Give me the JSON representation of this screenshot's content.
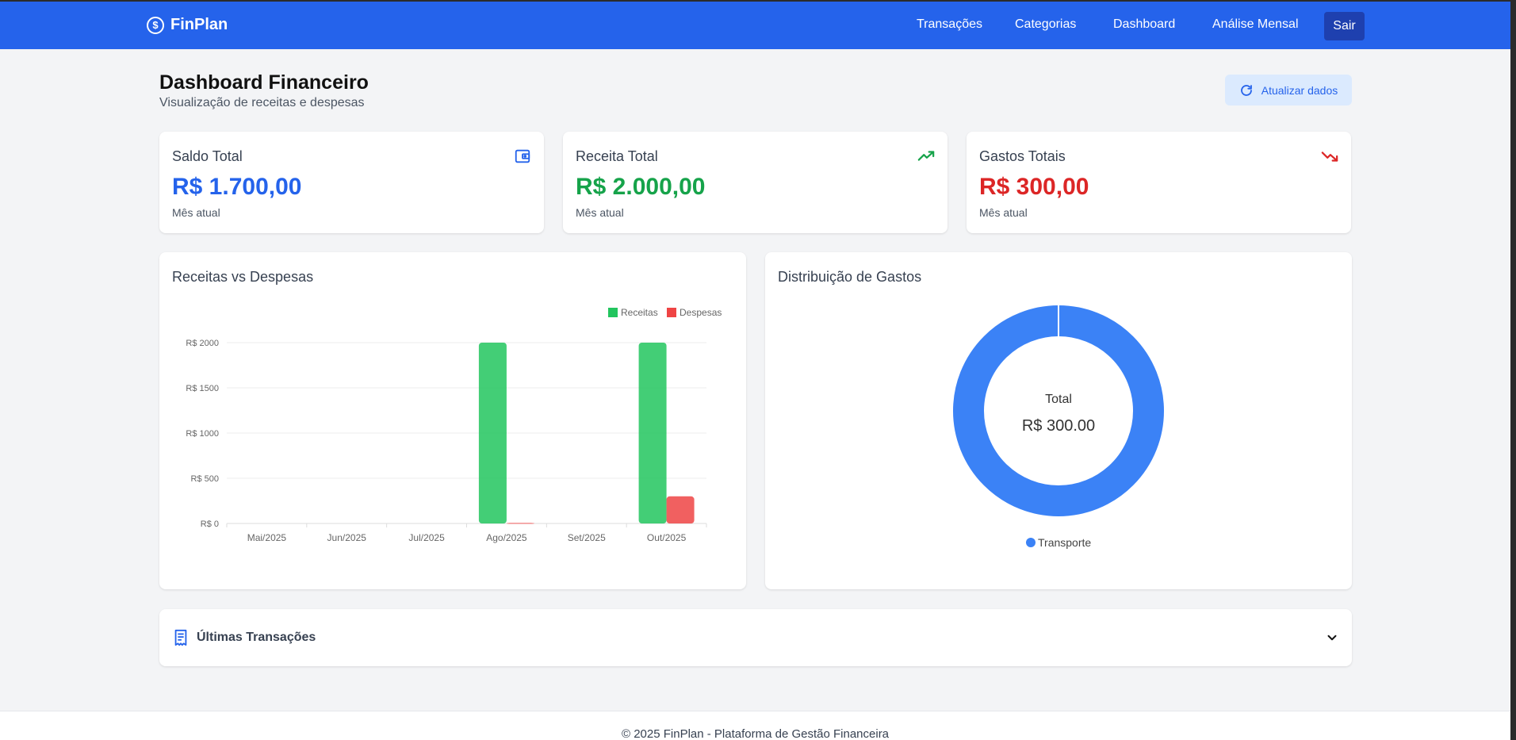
{
  "nav": {
    "brand": "FinPlan",
    "brand_symbol": "$",
    "links": [
      "Transações",
      "Categorias",
      "Dashboard",
      "Análise Mensal"
    ],
    "logout": "Sair"
  },
  "header": {
    "title": "Dashboard Financeiro",
    "subtitle": "Visualização de receitas e despesas",
    "refresh_label": "Atualizar dados"
  },
  "stats": [
    {
      "label": "Saldo Total",
      "value": "R$ 1.700,00",
      "note": "Mês atual",
      "color": "#2563eb",
      "icon": "wallet-icon"
    },
    {
      "label": "Receita Total",
      "value": "R$ 2.000,00",
      "note": "Mês atual",
      "color": "#16a34a",
      "icon": "trending-up-icon"
    },
    {
      "label": "Gastos Totais",
      "value": "R$ 300,00",
      "note": "Mês atual",
      "color": "#dc2626",
      "icon": "trending-down-icon"
    }
  ],
  "bar_chart_title": "Receitas vs Despesas",
  "donut_chart_title": "Distribuição de Gastos",
  "transactions": {
    "title": "Últimas Transações"
  },
  "footer": "© 2025 FinPlan - Plataforma de Gestão Financeira",
  "chart_data": [
    {
      "type": "bar",
      "categories": [
        "Mai/2025",
        "Jun/2025",
        "Jul/2025",
        "Ago/2025",
        "Set/2025",
        "Out/2025"
      ],
      "series": [
        {
          "name": "Receitas",
          "color": "#22c55e",
          "values": [
            0,
            0,
            0,
            2000,
            0,
            2000
          ]
        },
        {
          "name": "Despesas",
          "color": "#ef4444",
          "values": [
            0,
            0,
            0,
            5,
            0,
            300
          ]
        }
      ],
      "yticks": [
        0,
        500,
        1000,
        1500,
        2000
      ],
      "ytick_labels": [
        "R$ 0",
        "R$ 500",
        "R$ 1000",
        "R$ 1500",
        "R$ 2000"
      ],
      "ylim": [
        0,
        2000
      ],
      "legend": "top-right",
      "grid": true
    },
    {
      "type": "pie",
      "donut": true,
      "labels": [
        "Transporte"
      ],
      "values": [
        300
      ],
      "colors": [
        "#3b82f6"
      ],
      "center_label": "Total",
      "center_value": "R$ 300.00",
      "legend": "bottom"
    }
  ]
}
